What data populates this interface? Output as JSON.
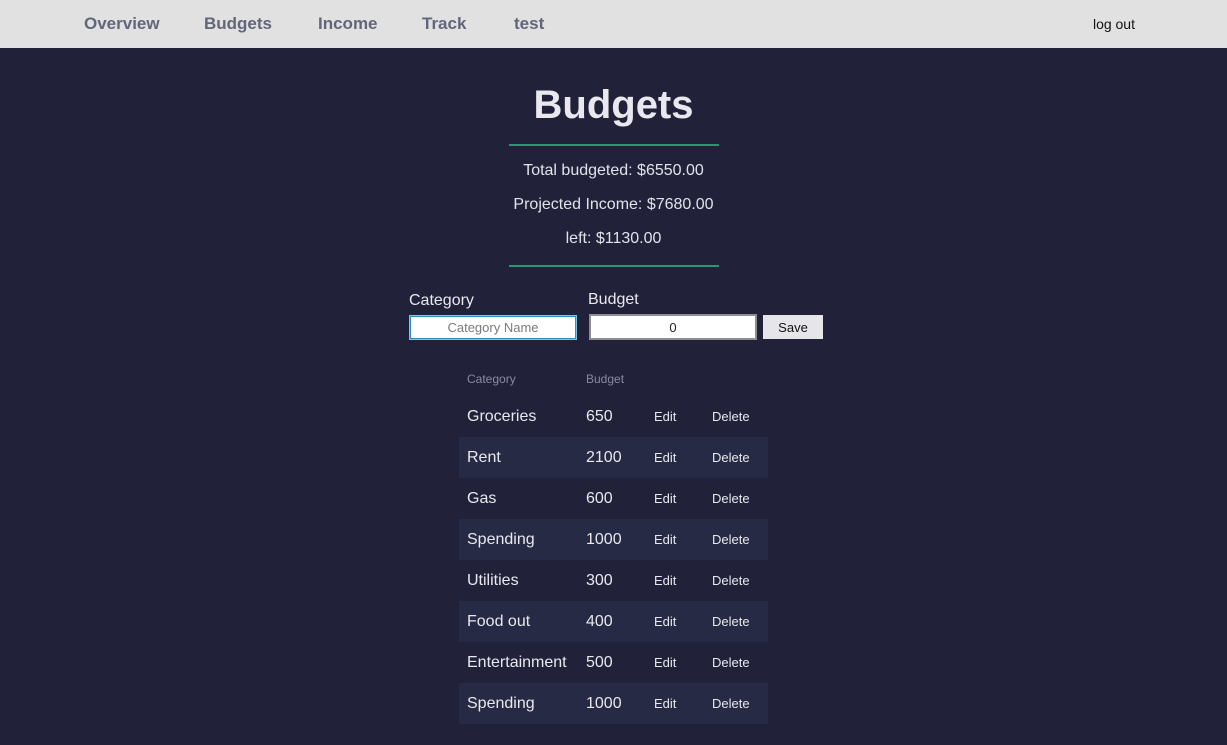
{
  "nav": {
    "items": [
      "Overview",
      "Budgets",
      "Income",
      "Track",
      "test"
    ],
    "logout_label": "log out"
  },
  "page": {
    "title": "Budgets",
    "total_budgeted": "Total budgeted: $6550.00",
    "projected_income": "Projected Income: $7680.00",
    "left": "left: $1130.00"
  },
  "form": {
    "category_label": "Category",
    "category_placeholder": "Category Name",
    "category_value": "",
    "budget_label": "Budget",
    "budget_value": "0",
    "save_label": "Save"
  },
  "table": {
    "headers": [
      "Category",
      "Budget"
    ],
    "edit_label": "Edit",
    "delete_label": "Delete",
    "rows": [
      {
        "category": "Groceries",
        "budget": "650"
      },
      {
        "category": "Rent",
        "budget": "2100"
      },
      {
        "category": "Gas",
        "budget": "600"
      },
      {
        "category": "Spending",
        "budget": "1000"
      },
      {
        "category": "Utilities",
        "budget": "300"
      },
      {
        "category": "Food out",
        "budget": "400"
      },
      {
        "category": "Entertainment",
        "budget": "500"
      },
      {
        "category": "Spending",
        "budget": "1000"
      }
    ]
  },
  "colors": {
    "background": "#21223a",
    "navbar": "#e1e1e1",
    "accent_divider": "#1f9a73",
    "alt_row": "#272a45"
  }
}
